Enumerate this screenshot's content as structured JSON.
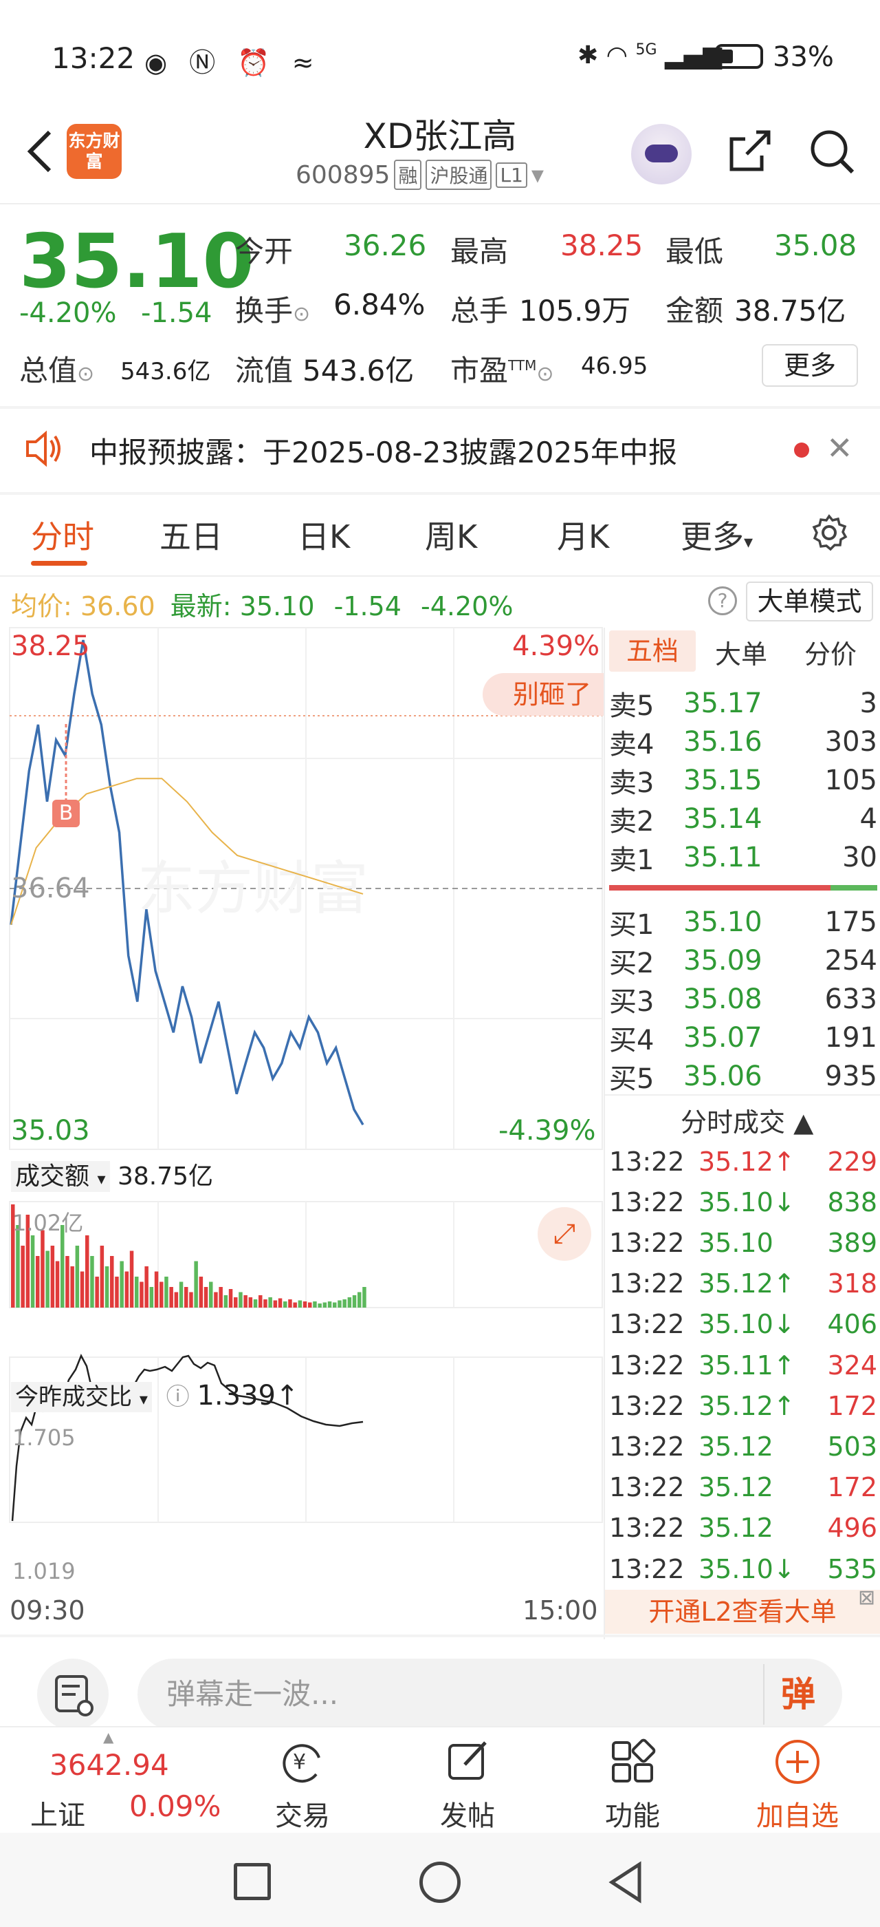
{
  "status_bar": {
    "time": "13:22",
    "left_icons": [
      "eye-icon",
      "nfc-icon",
      "alarm-icon",
      "signal-wave-icon"
    ],
    "right_icons": [
      "bluetooth-icon",
      "wifi-icon",
      "5g-icon",
      "cell-signal-icon"
    ],
    "network": "5G",
    "battery_pct": "33%"
  },
  "header": {
    "app_logo_text": "东方财富",
    "stock_name": "XD张江高",
    "stock_code": "600895",
    "tags": [
      "融",
      "沪股通",
      "L1"
    ]
  },
  "quote": {
    "price": "35.10",
    "change_pct": "-4.20%",
    "change_val": "-1.54",
    "fields": {
      "open_label": "今开",
      "open": "36.26",
      "high_label": "最高",
      "high": "38.25",
      "low_label": "最低",
      "low": "35.08",
      "turnover_label": "换手",
      "turnover": "6.84%",
      "volume_label": "总手",
      "volume": "105.9万",
      "amount_label": "金额",
      "amount": "38.75亿",
      "mktcap_label": "总值",
      "mktcap": "543.6亿",
      "float_label": "流值",
      "float": "543.6亿",
      "pe_label": "市盈",
      "pe_sup": "TTM",
      "pe": "46.95"
    },
    "more_btn": "更多"
  },
  "notice": {
    "text": "中报预披露：于2025-08-23披露2025年中报"
  },
  "tabs": [
    "分时",
    "五日",
    "日K",
    "周K",
    "月K",
    "更多"
  ],
  "info_line": {
    "avg_label": "均价:",
    "avg": "36.60",
    "latest_label": "最新:",
    "latest": "35.10",
    "chg": "-1.54",
    "pct": "-4.20%",
    "mode_btn": "大单模式"
  },
  "chart": {
    "y_high": "38.25",
    "y_mid": "36.64",
    "y_low": "35.03",
    "pct_high": "4.39%",
    "pct_low": "-4.39%",
    "watermark": "东方财富",
    "tag_bubble": "别砸了",
    "buy_marker": "B",
    "vol_selector": "成交额",
    "vol_total": "38.75亿",
    "vol_max": "1.02亿",
    "ratio_selector": "今昨成交比",
    "ratio_value": "1.339↑",
    "ratio_max": "1.705",
    "ratio_min": "1.019",
    "time_start": "09:30",
    "time_end": "15:00"
  },
  "chart_data": {
    "type": "line",
    "ylim": [
      35.03,
      38.25
    ],
    "series": [
      {
        "values": [
          36.4,
          36.9,
          37.4,
          37.7,
          37.2,
          37.6,
          37.5,
          37.9,
          38.25,
          37.9,
          37.7,
          37.3,
          37.0,
          36.2,
          35.9,
          36.5,
          36.1,
          35.9,
          35.7,
          36.0,
          35.8,
          35.5,
          35.7,
          35.9,
          35.6,
          35.3,
          35.5,
          35.7,
          35.6,
          35.4,
          35.5,
          35.7,
          35.6,
          35.8,
          35.7,
          35.5,
          35.6,
          35.4,
          35.2,
          35.1
        ]
      },
      {
        "values": [
          36.4,
          36.9,
          37.1,
          37.25,
          37.3,
          37.35,
          37.35,
          37.2,
          37.0,
          36.85,
          36.8,
          36.75,
          36.7,
          36.65,
          36.6
        ]
      }
    ]
  },
  "orderbook": {
    "tabs": [
      "五档",
      "大单",
      "分价"
    ],
    "asks": [
      {
        "label": "卖5",
        "price": "35.17",
        "vol": "3"
      },
      {
        "label": "卖4",
        "price": "35.16",
        "vol": "303"
      },
      {
        "label": "卖3",
        "price": "35.15",
        "vol": "105"
      },
      {
        "label": "卖2",
        "price": "35.14",
        "vol": "4"
      },
      {
        "label": "卖1",
        "price": "35.11",
        "vol": "30"
      }
    ],
    "bids": [
      {
        "label": "买1",
        "price": "35.10",
        "vol": "175"
      },
      {
        "label": "买2",
        "price": "35.09",
        "vol": "254"
      },
      {
        "label": "买3",
        "price": "35.08",
        "vol": "633"
      },
      {
        "label": "买4",
        "price": "35.07",
        "vol": "191"
      },
      {
        "label": "买5",
        "price": "35.06",
        "vol": "935"
      }
    ],
    "ticks_title": "分时成交 ▲",
    "ticks": [
      {
        "time": "13:22",
        "price": "35.12↑",
        "vol": "229",
        "pc": "red",
        "vc": "red"
      },
      {
        "time": "13:22",
        "price": "35.10↓",
        "vol": "838",
        "pc": "green",
        "vc": "green"
      },
      {
        "time": "13:22",
        "price": "35.10",
        "vol": "389",
        "pc": "green",
        "vc": "green"
      },
      {
        "time": "13:22",
        "price": "35.12↑",
        "vol": "318",
        "pc": "green",
        "vc": "red"
      },
      {
        "time": "13:22",
        "price": "35.10↓",
        "vol": "406",
        "pc": "green",
        "vc": "green"
      },
      {
        "time": "13:22",
        "price": "35.11↑",
        "vol": "324",
        "pc": "green",
        "vc": "red"
      },
      {
        "time": "13:22",
        "price": "35.12↑",
        "vol": "172",
        "pc": "green",
        "vc": "red"
      },
      {
        "time": "13:22",
        "price": "35.12",
        "vol": "503",
        "pc": "green",
        "vc": "green"
      },
      {
        "time": "13:22",
        "price": "35.12",
        "vol": "172",
        "pc": "green",
        "vc": "red"
      },
      {
        "time": "13:22",
        "price": "35.12",
        "vol": "496",
        "pc": "green",
        "vc": "red"
      },
      {
        "time": "13:22",
        "price": "35.10↓",
        "vol": "535",
        "pc": "green",
        "vc": "green"
      }
    ],
    "l2_banner": "开通L2查看大单"
  },
  "comment_bar": {
    "placeholder": "弹幕走一波...",
    "danmu_btn": "弹"
  },
  "bottom_nav": {
    "index_value": "3642.94",
    "index_name": "上证",
    "index_pct": "0.09%",
    "items": [
      {
        "label": "交易",
        "icon": "yen-cycle-icon"
      },
      {
        "label": "发帖",
        "icon": "edit-icon"
      },
      {
        "label": "功能",
        "icon": "grid-icon"
      },
      {
        "label": "加自选",
        "icon": "plus-circle-icon"
      }
    ]
  },
  "colors": {
    "up": "#e03b3b",
    "down": "#2f9a35",
    "accent": "#e5541e",
    "price_line": "#3b6fb0",
    "avg_line": "#e8b34a"
  }
}
